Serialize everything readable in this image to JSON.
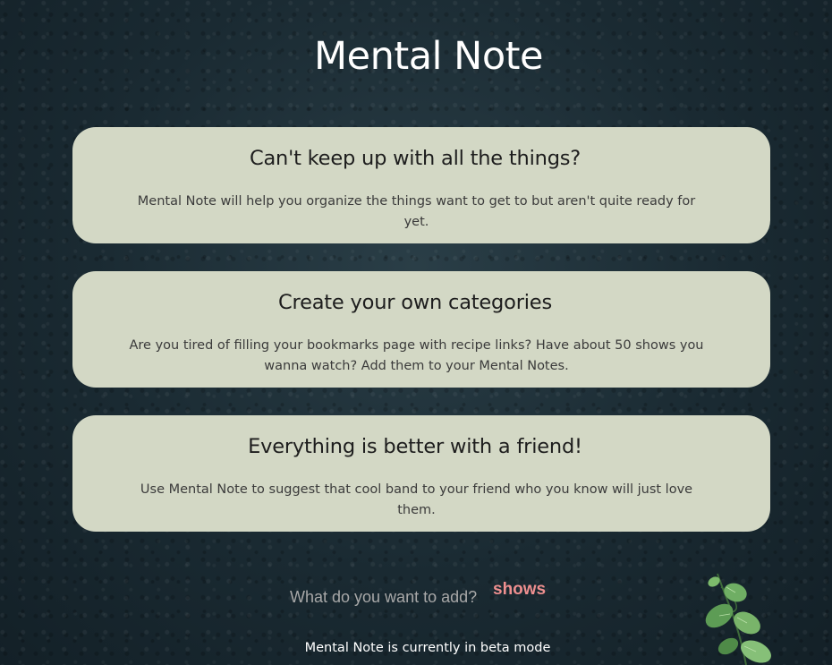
{
  "header": {
    "title": "Mental Note"
  },
  "cards": [
    {
      "heading": "Can't keep up with all the things?",
      "body": "Mental Note will help you organize the things want to get to but aren't quite ready for yet."
    },
    {
      "heading": "Create your own categories",
      "body": "Are you tired of filling your bookmarks page with recipe links? Have about 50 shows you wanna watch? Add them to your Mental Notes."
    },
    {
      "heading": "Everything is better with a friend!",
      "body": "Use Mental Note to suggest that cool band to your friend who you know will just love them."
    }
  ],
  "prompt": {
    "question": "What do you want to add?",
    "rotating_word": "shows"
  },
  "footer": {
    "text": "Mental Note is currently in beta mode"
  },
  "colors": {
    "background": "#1b2b33",
    "card": "#d3d8c5",
    "accent_word": "#ee8f8f",
    "title": "#ffffff"
  },
  "icons": {
    "plant": "plant-leaves-icon"
  }
}
